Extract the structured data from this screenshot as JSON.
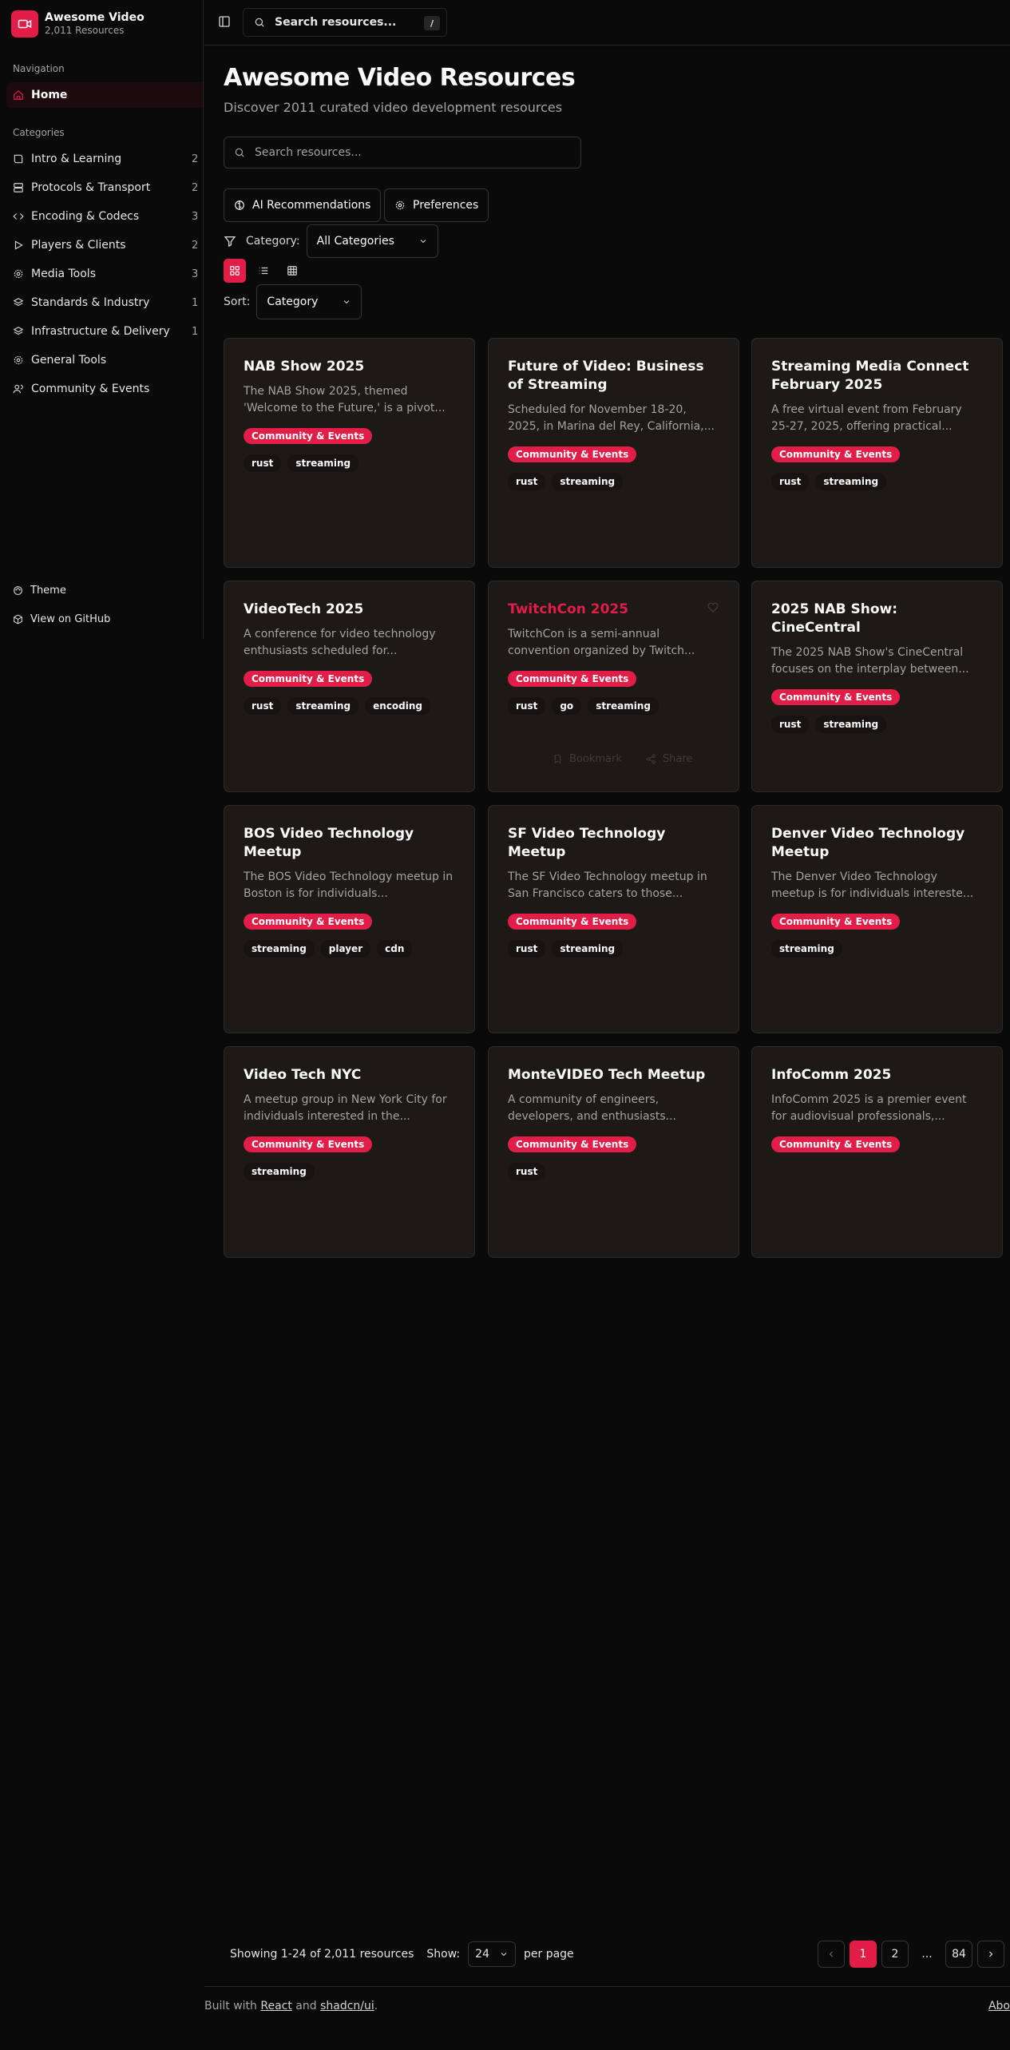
{
  "brand": {
    "title": "Awesome Video",
    "subtitle": "2,011 Resources"
  },
  "sidebar": {
    "nav_label": "Navigation",
    "home": "Home",
    "categories_label": "Categories",
    "categories": [
      {
        "label": "Intro & Learning",
        "count": "2"
      },
      {
        "label": "Protocols & Transport",
        "count": "2"
      },
      {
        "label": "Encoding & Codecs",
        "count": "3"
      },
      {
        "label": "Players & Clients",
        "count": "2"
      },
      {
        "label": "Media Tools",
        "count": "3"
      },
      {
        "label": "Standards & Industry",
        "count": "1"
      },
      {
        "label": "Infrastructure & Delivery",
        "count": "1"
      },
      {
        "label": "General Tools",
        "count": ""
      },
      {
        "label": "Community & Events",
        "count": ""
      }
    ],
    "theme": "Theme",
    "github": "View on GitHub"
  },
  "topbar": {
    "search_placeholder": "Search resources...",
    "shortcut": "/"
  },
  "page": {
    "title": "Awesome Video Resources",
    "subtitle": "Discover 2011 curated video development resources",
    "search_placeholder": "Search resources...",
    "ai_button": "AI Recommendations",
    "prefs_button": "Preferences",
    "category_label": "Category:",
    "category_value": "All Categories",
    "sort_label": "Sort:",
    "sort_value": "Category"
  },
  "cards": [
    {
      "title": "NAB Show 2025",
      "desc": "The NAB Show 2025, themed 'Welcome to the Future,' is a pivot...",
      "category": "Community & Events",
      "tags": [
        "rust",
        "streaming"
      ]
    },
    {
      "title": "Future of Video: Business of Streaming",
      "desc": "Scheduled for November 18-20, 2025, in Marina del Rey, California,...",
      "category": "Community & Events",
      "tags": [
        "rust",
        "streaming"
      ]
    },
    {
      "title": "Streaming Media Connect February 2025",
      "desc": "A free virtual event from February 25-27, 2025, offering practical...",
      "category": "Community & Events",
      "tags": [
        "rust",
        "streaming"
      ]
    },
    {
      "title": "VideoTech 2025",
      "desc": "A conference for video technology enthusiasts scheduled for...",
      "category": "Community & Events",
      "tags": [
        "rust",
        "streaming",
        "encoding"
      ]
    },
    {
      "title": "TwitchCon 2025",
      "desc": "TwitchCon is a semi-annual convention organized by Twitch...",
      "category": "Community & Events",
      "tags": [
        "rust",
        "go",
        "streaming"
      ]
    },
    {
      "title": "2025 NAB Show: CineCentral",
      "desc": "The 2025 NAB Show's CineCentral focuses on the interplay between...",
      "category": "Community & Events",
      "tags": [
        "rust",
        "streaming"
      ]
    },
    {
      "title": "BOS Video Technology Meetup",
      "desc": "The BOS Video Technology meetup in Boston is for individuals...",
      "category": "Community & Events",
      "tags": [
        "streaming",
        "player",
        "cdn"
      ]
    },
    {
      "title": "SF Video Technology Meetup",
      "desc": "The SF Video Technology meetup in San Francisco caters to those...",
      "category": "Community & Events",
      "tags": [
        "rust",
        "streaming"
      ]
    },
    {
      "title": "Denver Video Technology Meetup",
      "desc": "The Denver Video Technology meetup is for individuals intereste...",
      "category": "Community & Events",
      "tags": [
        "streaming"
      ]
    },
    {
      "title": "Video Tech NYC",
      "desc": "A meetup group in New York City for individuals interested in the...",
      "category": "Community & Events",
      "tags": [
        "streaming"
      ]
    },
    {
      "title": "MonteVIDEO Tech Meetup",
      "desc": "A community of engineers, developers, and enthusiasts...",
      "category": "Community & Events",
      "tags": [
        "rust"
      ]
    },
    {
      "title": "InfoComm 2025",
      "desc": "InfoComm 2025 is a premier event for audiovisual professionals,...",
      "category": "Community & Events",
      "tags": []
    }
  ],
  "card_actions": {
    "bookmark": "Bookmark",
    "share": "Share"
  },
  "pagination": {
    "showing": "Showing 1-24 of 2,011 resources",
    "show_label": "Show:",
    "per_page_value": "24",
    "per_page_label": "per page",
    "pages": [
      "1",
      "2",
      "...",
      "84"
    ]
  },
  "footer": {
    "prefix": "Built with",
    "react": "React",
    "and": "and",
    "shadcn": "shadcn/ui",
    "suffix": ".",
    "right": "Abo"
  },
  "colors": {
    "accent": "#e11d48",
    "background": "#0a0a0a",
    "card": "#1c1917"
  }
}
